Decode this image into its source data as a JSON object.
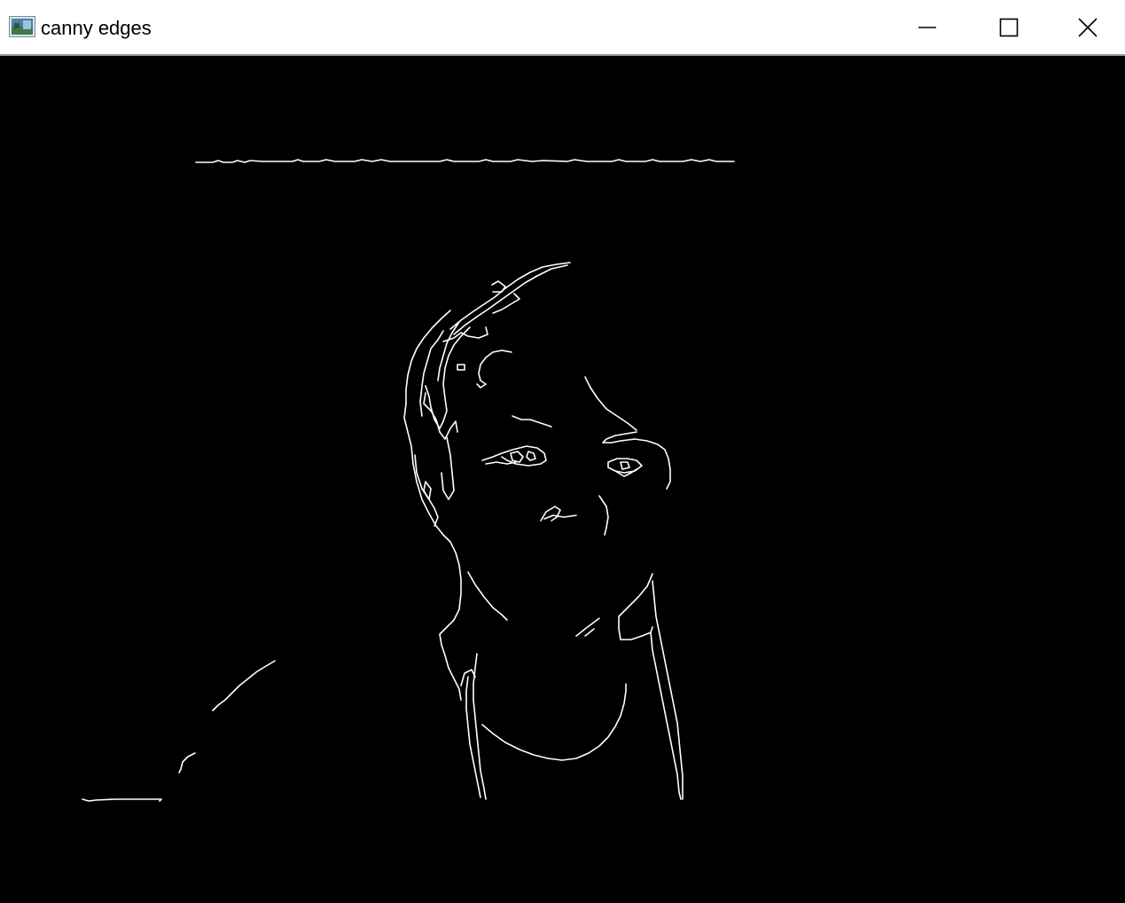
{
  "window": {
    "title": "canny edges",
    "icon": "image-window-icon",
    "controls": {
      "minimize_icon": "minimize-icon",
      "maximize_icon": "maximize-icon",
      "close_icon": "close-icon"
    }
  },
  "canvas": {
    "background_color": "#000000",
    "edge_color": "#ffffff"
  }
}
